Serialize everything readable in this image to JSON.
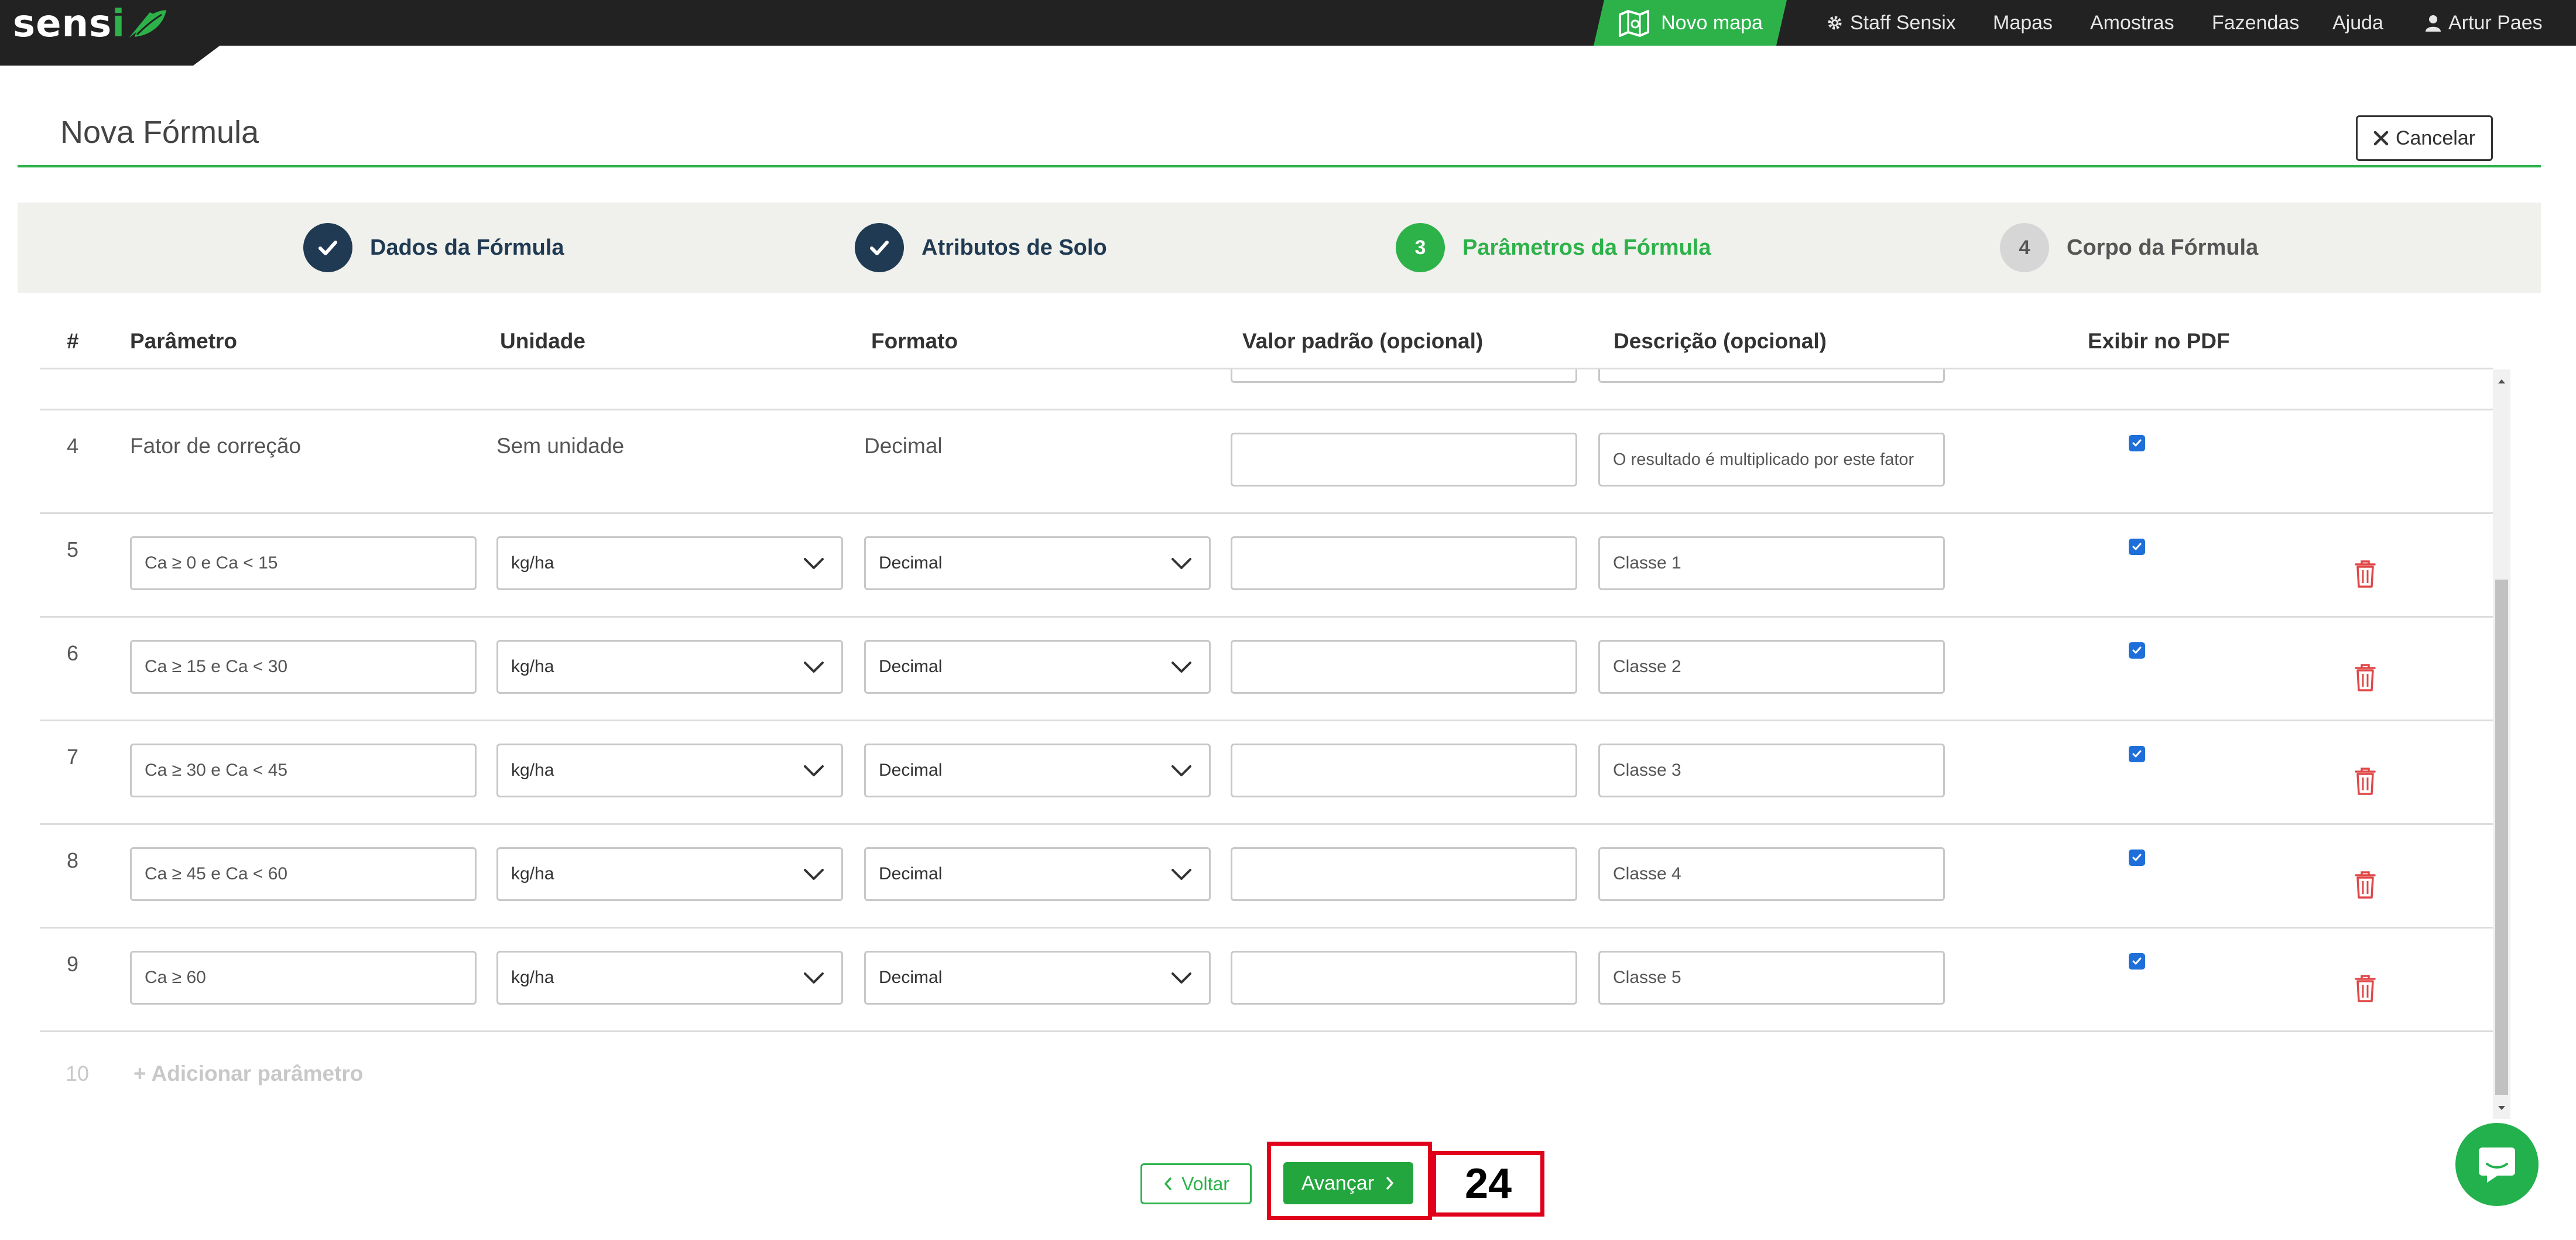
{
  "navbar": {
    "logo": "sensix",
    "novo_mapa": "Novo mapa",
    "items": [
      {
        "label": "Staff Sensix",
        "icon": "gear-icon"
      },
      {
        "label": "Mapas"
      },
      {
        "label": "Amostras"
      },
      {
        "label": "Fazendas"
      },
      {
        "label": "Ajuda"
      },
      {
        "label": "Artur Paes",
        "icon": "user-icon"
      }
    ]
  },
  "header": {
    "title": "Nova Fórmula",
    "cancel_label": "Cancelar"
  },
  "stepper": {
    "steps": [
      {
        "label": "Dados da Fórmula",
        "status": "done"
      },
      {
        "label": "Atributos de Solo",
        "status": "done"
      },
      {
        "number": "3",
        "label": "Parâmetros da Fórmula",
        "status": "active"
      },
      {
        "number": "4",
        "label": "Corpo da Fórmula",
        "status": "todo"
      }
    ]
  },
  "table": {
    "columns": [
      "#",
      "Parâmetro",
      "Unidade",
      "Formato",
      "Valor padrão (opcional)",
      "Descrição (opcional)",
      "Exibir no PDF"
    ],
    "fixed_row": {
      "num": "4",
      "parametro": "Fator de correção",
      "unidade": "Sem unidade",
      "formato": "Decimal",
      "valor_padrao": "",
      "descricao": "O resultado é multiplicado por este fator",
      "exibir_pdf": true
    },
    "rows": [
      {
        "num": "5",
        "parametro": "Ca ≥ 0 e Ca < 15",
        "unidade": "kg/ha",
        "formato": "Decimal",
        "valor_padrao": "",
        "descricao": "Classe 1",
        "exibir_pdf": true
      },
      {
        "num": "6",
        "parametro": "Ca ≥ 15 e Ca < 30",
        "unidade": "kg/ha",
        "formato": "Decimal",
        "valor_padrao": "",
        "descricao": "Classe 2",
        "exibir_pdf": true
      },
      {
        "num": "7",
        "parametro": "Ca ≥ 30 e Ca < 45",
        "unidade": "kg/ha",
        "formato": "Decimal",
        "valor_padrao": "",
        "descricao": "Classe 3",
        "exibir_pdf": true
      },
      {
        "num": "8",
        "parametro": "Ca ≥ 45 e Ca < 60",
        "unidade": "kg/ha",
        "formato": "Decimal",
        "valor_padrao": "",
        "descricao": "Classe 4",
        "exibir_pdf": true
      },
      {
        "num": "9",
        "parametro": "Ca ≥ 60",
        "unidade": "kg/ha",
        "formato": "Decimal",
        "valor_padrao": "",
        "descricao": "Classe 5",
        "exibir_pdf": true
      }
    ],
    "add_row": {
      "num": "10",
      "label": "+ Adicionar parâmetro"
    }
  },
  "footer": {
    "voltar_label": "Voltar",
    "avancar_label": "Avançar",
    "annotation": "24"
  },
  "colors": {
    "brand_green": "#2db24a",
    "navy": "#1f3a52",
    "delete_red": "#e04848",
    "highlight_red": "#e0001b"
  }
}
